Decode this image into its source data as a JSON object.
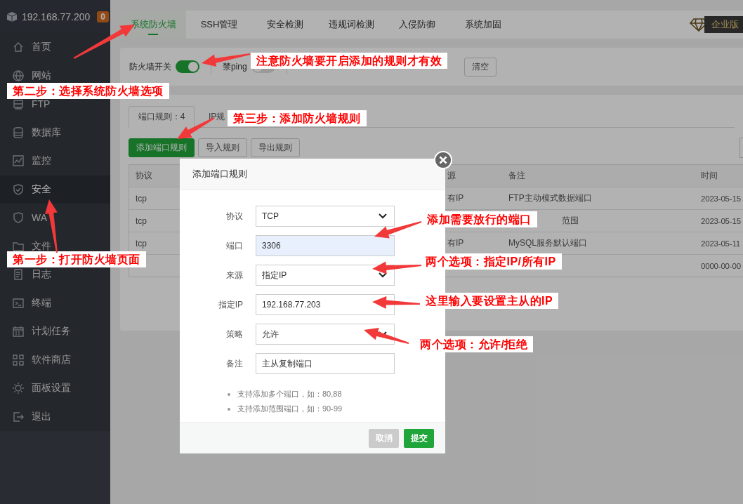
{
  "sidebar": {
    "host": "192.168.77.200",
    "badge": "0",
    "items": [
      {
        "label": "首页",
        "selected": false
      },
      {
        "label": "网站",
        "selected": false
      },
      {
        "label": "FTP",
        "selected": false
      },
      {
        "label": "数据库",
        "selected": false
      },
      {
        "label": "监控",
        "selected": false
      },
      {
        "label": "安全",
        "selected": true
      },
      {
        "label": "WA",
        "selected": false
      },
      {
        "label": "文件",
        "selected": false
      },
      {
        "label": "日志",
        "selected": false
      },
      {
        "label": "终端",
        "selected": false
      },
      {
        "label": "计划任务",
        "selected": false
      },
      {
        "label": "软件商店",
        "selected": false
      },
      {
        "label": "面板设置",
        "selected": false
      },
      {
        "label": "退出",
        "selected": false
      }
    ]
  },
  "tabs": [
    {
      "label": "系统防火墙",
      "selected": true
    },
    {
      "label": "SSH管理",
      "selected": false
    },
    {
      "label": "安全检测",
      "selected": false
    },
    {
      "label": "违规词检测",
      "selected": false
    },
    {
      "label": "入侵防御",
      "selected": false
    },
    {
      "label": "系统加固",
      "selected": false
    }
  ],
  "edition": "企业版",
  "toolbar": {
    "switches": [
      {
        "label": "防火墙开关",
        "on": true
      },
      {
        "label": "禁ping",
        "on": false
      }
    ],
    "clear_button": "清空"
  },
  "rule_tabs": [
    {
      "label": "端口规则：4",
      "selected": true
    },
    {
      "label": "IP规",
      "selected": false
    }
  ],
  "actions": [
    {
      "label": "添加端口规则",
      "kind": "primary"
    },
    {
      "label": "导入规则",
      "kind": "default"
    },
    {
      "label": "导出规则",
      "kind": "default"
    }
  ],
  "table": {
    "columns": [
      "协议",
      "源",
      "备注",
      "时间"
    ],
    "rows": [
      {
        "protocol": "tcp",
        "source": "有IP",
        "remark": "FTP主动模式数据端口",
        "time": "2023-05-15"
      },
      {
        "protocol": "tcp",
        "remark": "范围",
        "time": "2023-05-15"
      },
      {
        "protocol": "tcp",
        "source": "有IP",
        "remark": "MySQL服务默认端口",
        "time": "2023-05-11"
      },
      {
        "time": "0000-00-00"
      }
    ]
  },
  "dialog": {
    "title": "添加端口规则",
    "fields": [
      {
        "label": "协议",
        "kind": "select",
        "value": "TCP",
        "autofilled": false
      },
      {
        "label": "端口",
        "kind": "input",
        "value": "3306",
        "autofilled": true
      },
      {
        "label": "来源",
        "kind": "select",
        "value": "指定IP",
        "autofilled": false
      },
      {
        "label": "指定IP",
        "kind": "input",
        "value": "192.168.77.203",
        "autofilled": false
      },
      {
        "label": "策略",
        "kind": "select",
        "value": "允许",
        "autofilled": false
      },
      {
        "label": "备注",
        "kind": "input",
        "value": "主从复制端口",
        "autofilled": false
      }
    ],
    "notes": [
      "支持添加多个端口，如：80,88",
      "支持添加范围端口，如：90-99"
    ],
    "buttons": [
      {
        "label": "取消",
        "kind": "cancel"
      },
      {
        "label": "提交",
        "kind": "primary"
      }
    ]
  },
  "annotations": [
    "第二步：选择系统防火墙选项",
    "注意防火墙要开启添加的规则才有效",
    "第三步：添加防火墙规则",
    "第一步：打开防火墙页面",
    "添加需要放行的端口",
    "两个选项：指定IP/所有IP",
    "这里输入要设置主从的IP",
    "两个选项：允许/拒绝"
  ]
}
